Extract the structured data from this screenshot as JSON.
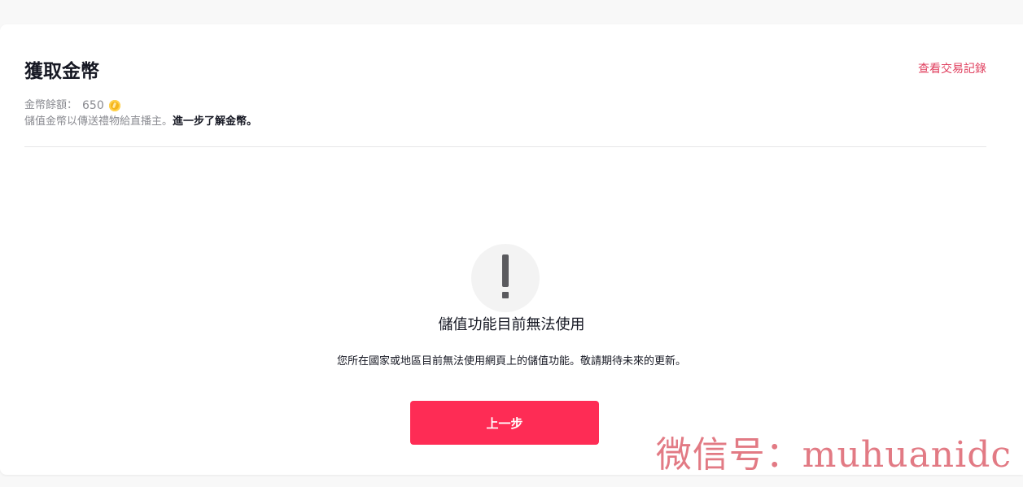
{
  "header": {
    "title": "獲取金幣",
    "history_link": "查看交易記錄",
    "balance_label": "金幣餘額：",
    "balance_value": "650",
    "description": "儲值金幣以傳送禮物給直播主。",
    "learn_more_link": "進一步了解金幣。"
  },
  "empty_state": {
    "icon": "exclamation-icon",
    "title": "儲值功能目前無法使用",
    "description": "您所在國家或地區目前無法使用網頁上的儲值功能。敬請期待未來的更新。",
    "button_label": "上一步"
  },
  "watermark": {
    "text": "微信号：muhuanidc"
  },
  "colors": {
    "accent": "#fe2c55",
    "link": "#e0405f",
    "coin": "#f5b51a"
  }
}
